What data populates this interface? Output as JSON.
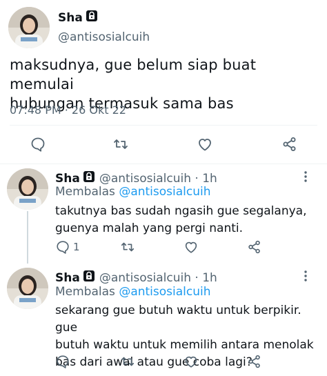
{
  "main_tweet": {
    "display_name": "Sha",
    "handle": "@antisosialcuih",
    "text_line1": "maksudnya, gue belum siap buat memulai",
    "text_line2": "hubungan termasuk sama bas",
    "timestamp": "07:48 PM · 26 Okt 22"
  },
  "replies": [
    {
      "display_name": "Sha",
      "handle_time": "@antisosialcuih · 1h",
      "replying_prefix": "Membalas",
      "replying_to": "@antisosialcuih",
      "text_line1": "takutnya bas sudah ngasih gue segalanya,",
      "text_line2": "guenya malah yang pergi nanti.",
      "reply_count": "1"
    },
    {
      "display_name": "Sha",
      "handle_time": "@antisosialcuih · 1h",
      "replying_prefix": "Membalas",
      "replying_to": "@antisosialcuih",
      "text_line1": "sekarang gue butuh waktu untuk berpikir. gue",
      "text_line2": "butuh waktu untuk memilih antara menolak",
      "text_line3": "bas dari awal atau gue coba lagi?",
      "reply_count": ""
    }
  ],
  "colors": {
    "accent": "#1d9bf0",
    "secondary_text": "#536471",
    "divider": "#eff3f4"
  }
}
